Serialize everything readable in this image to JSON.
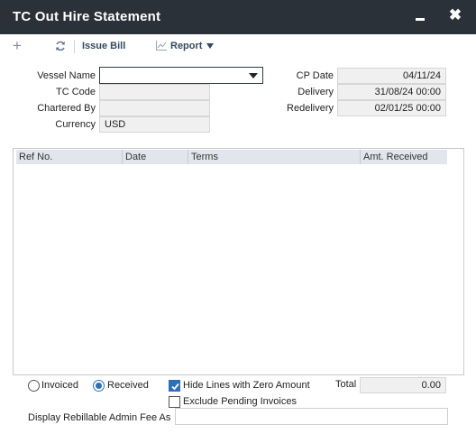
{
  "window": {
    "title": "TC Out Hire Statement",
    "close_glyph": "✖"
  },
  "toolbar": {
    "add_glyph": "+",
    "issue_bill_label": "Issue Bill",
    "report_label": "Report"
  },
  "form": {
    "vessel_name_label": "Vessel Name",
    "vessel_name_value": "",
    "tc_code_label": "TC Code",
    "tc_code_value": "",
    "chartered_by_label": "Chartered By",
    "chartered_by_value": "",
    "currency_label": "Currency",
    "currency_value": "USD",
    "cp_date_label": "CP Date",
    "cp_date_value": "04/11/24",
    "delivery_label": "Delivery",
    "delivery_value": "31/08/24 00:00",
    "redelivery_label": "Redelivery",
    "redelivery_value": "02/01/25 00:00"
  },
  "grid": {
    "columns": [
      "Ref No.",
      "Date",
      "Terms",
      "Amt. Received"
    ],
    "rows": []
  },
  "options": {
    "invoiced_label": "Invoiced",
    "invoiced_selected": false,
    "received_label": "Received",
    "received_selected": true,
    "hide_zero_label": "Hide Lines with Zero Amount",
    "hide_zero_checked": true,
    "exclude_pending_label": "Exclude Pending Invoices",
    "exclude_pending_checked": false,
    "total_label": "Total",
    "total_value": "0.00",
    "admin_fee_label": "Display Rebillable Admin Fee As",
    "admin_fee_value": ""
  },
  "colors": {
    "titlebar": "#2b3138",
    "accent": "#2d6fb8",
    "toolbar_text": "#34495e"
  }
}
